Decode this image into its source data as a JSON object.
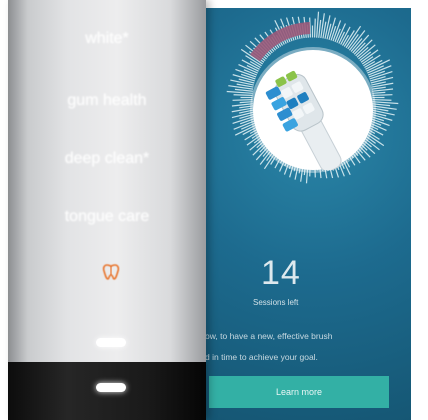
{
  "handle": {
    "modes": [
      {
        "label": "white*"
      },
      {
        "label": "gum health"
      },
      {
        "label": "deep clean*"
      },
      {
        "label": "tongue care"
      }
    ],
    "smart_icon": "toothbrush-smart-icon",
    "mode_color": "#ffffff",
    "icon_color": "#e8732c"
  },
  "app": {
    "sessions_count": "14",
    "sessions_label": "Sessions left",
    "message_line1": "ow, to have a new, effective brush",
    "message_line2": "d in time to achieve your goal.",
    "button_label": "Learn more",
    "background_color": "#1d6b8f",
    "button_color": "#33b0a5",
    "progress_color": "#9b5a7a"
  }
}
